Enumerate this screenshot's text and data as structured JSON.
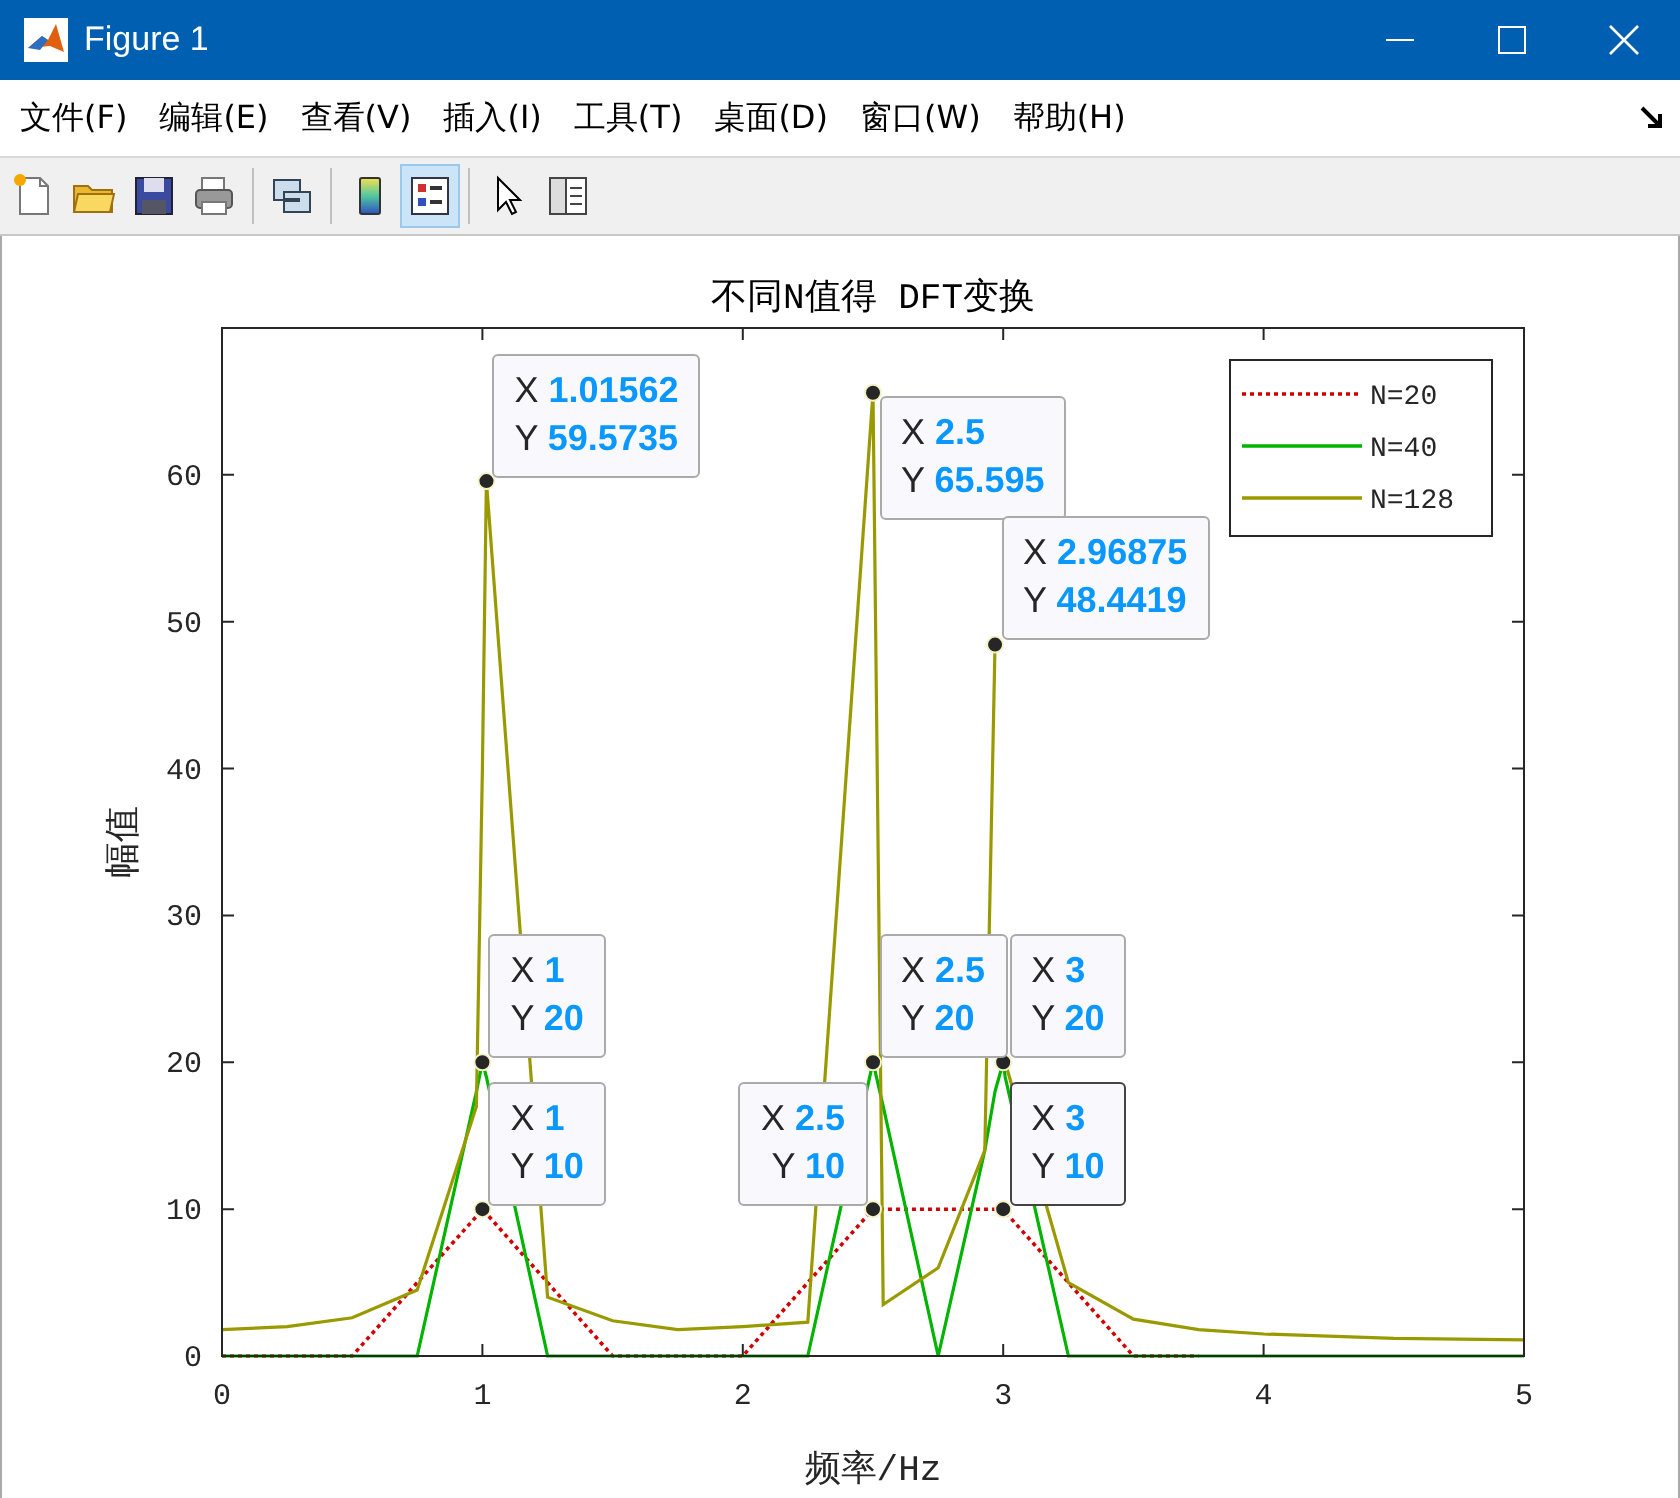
{
  "window": {
    "title": "Figure 1"
  },
  "menu": [
    "文件(F)",
    "编辑(E)",
    "查看(V)",
    "插入(I)",
    "工具(T)",
    "桌面(D)",
    "窗口(W)",
    "帮助(H)"
  ],
  "toolbar": [
    {
      "on": false
    },
    {
      "on": false
    },
    {
      "on": false
    },
    {
      "on": false
    },
    {
      "on": false
    },
    {
      "on": false
    },
    {
      "on": true
    },
    {
      "on": false
    },
    {
      "on": false
    }
  ],
  "axes": {
    "chart_data": {
      "type": "line",
      "title": "不同N值得 DFT变换",
      "xlabel": "频率/Hz",
      "ylabel": "幅值",
      "x": [
        0,
        0.25,
        0.5,
        0.75,
        0.9766,
        1,
        1.0156,
        1.25,
        1.5,
        1.75,
        2,
        2.25,
        2.5,
        2.5391,
        2.75,
        2.9297,
        2.9688,
        3,
        3.0078,
        3.25,
        3.5,
        3.75,
        4,
        4.5,
        5
      ],
      "series": [
        {
          "name": "N=20",
          "color": "#d40000",
          "line_style": "dotted",
          "values": [
            0,
            0,
            0,
            5,
            9.5,
            10,
            9.7,
            5,
            0,
            0,
            0,
            5,
            10,
            10,
            10,
            10,
            10,
            10,
            9.8,
            5,
            0,
            0,
            null,
            null,
            null
          ]
        },
        {
          "name": "N=40",
          "color": "#00b400",
          "line_style": "solid",
          "values": [
            0,
            0,
            0,
            0,
            18,
            20,
            19,
            0,
            0,
            0,
            0,
            0,
            20,
            17,
            0,
            14,
            18,
            20,
            19,
            0,
            0,
            0,
            0,
            0,
            0
          ]
        },
        {
          "name": "N=128",
          "color": "#9a9a00",
          "line_style": "solid",
          "values": [
            1.8,
            2,
            2.6,
            4.5,
            17,
            40,
            59.6,
            4,
            2.4,
            1.8,
            2,
            2.3,
            65.6,
            3.5,
            6,
            14,
            48.4,
            null,
            20,
            5,
            2.5,
            1.8,
            1.5,
            1.2,
            1.1
          ]
        }
      ],
      "xlim": [
        0,
        5
      ],
      "ylim": [
        0,
        70
      ],
      "xticks": [
        0,
        1,
        2,
        3,
        4,
        5
      ],
      "yticks": [
        0,
        10,
        20,
        30,
        40,
        50,
        60
      ],
      "legend": true,
      "annotations": [
        {
          "x": 1.01562,
          "y": 59.5735,
          "text": "X **1.01562**\nY **59.5735**"
        },
        {
          "x": 2.5,
          "y": 65.595,
          "text": "X **2.5**\nY **65.595**"
        },
        {
          "x": 2.96875,
          "y": 48.4419,
          "text": "X **2.96875**\nY **48.4419**"
        },
        {
          "x": 1,
          "y": 20,
          "text": "X **1**\nY **20**"
        },
        {
          "x": 1,
          "y": 10,
          "text": "X **1**\nY **10**"
        },
        {
          "x": 2.5,
          "y": 20,
          "text": "X **2.5**\nY **20**"
        },
        {
          "x": 3,
          "y": 20,
          "text": "X **3**\nY **20**"
        },
        {
          "x": 2.5,
          "y": 10,
          "text": "X **2.5**\nY **10**"
        },
        {
          "x": 3,
          "y": 10,
          "text": "X **3**\nY **10**"
        }
      ]
    },
    "data_tips": [
      {
        "selected": false
      },
      {
        "selected": false
      },
      {
        "selected": false
      },
      {
        "selected": false
      },
      {
        "selected": false
      },
      {
        "selected": false
      },
      {
        "selected": false
      },
      {
        "selected": false
      },
      {
        "selected": true
      }
    ]
  }
}
